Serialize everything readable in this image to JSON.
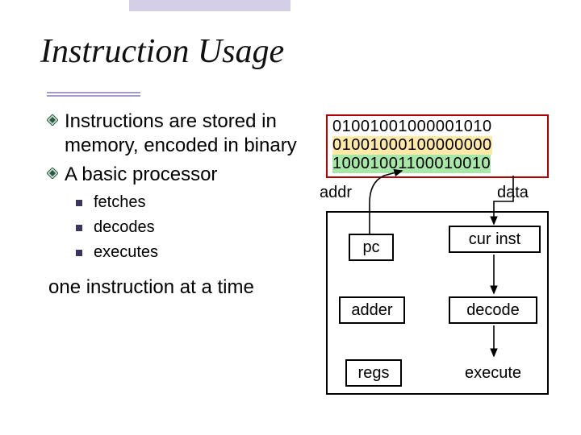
{
  "title": "Instruction Usage",
  "bullets": [
    "Instructions are stored in memory, encoded in binary",
    "A basic processor"
  ],
  "subbullets": [
    "fetches",
    "decodes",
    "executes"
  ],
  "closing": "one instruction at a time",
  "memory": {
    "line1": "01001001000001010",
    "line2": "01001000100000000",
    "line3": "10001001100010010"
  },
  "labels": {
    "addr": "addr",
    "data": "data"
  },
  "boxes": {
    "pc": "pc",
    "cur_inst": "cur inst",
    "adder": "adder",
    "decode": "decode",
    "regs": "regs",
    "execute": "execute"
  }
}
